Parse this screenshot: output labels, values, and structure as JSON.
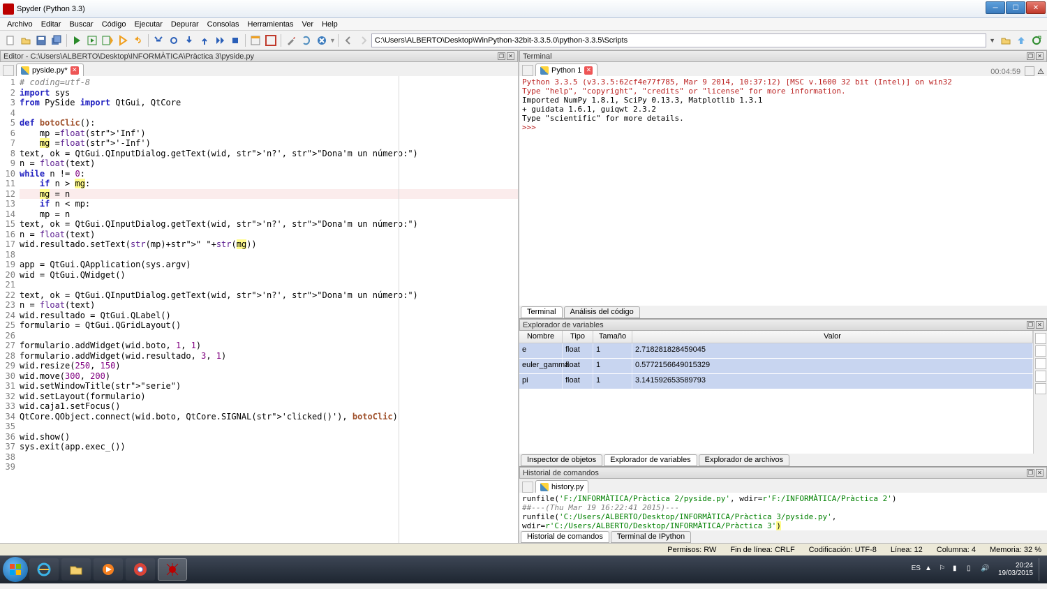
{
  "window": {
    "title": "Spyder (Python 3.3)"
  },
  "menu": [
    "Archivo",
    "Editar",
    "Buscar",
    "Código",
    "Ejecutar",
    "Depurar",
    "Consolas",
    "Herramientas",
    "Ver",
    "Help"
  ],
  "path": "C:\\Users\\ALBERTO\\Desktop\\WinPython-32bit-3.3.5.0\\python-3.3.5\\Scripts",
  "editor": {
    "pane_title": "Editor - C:\\Users\\ALBERTO\\Desktop\\INFORMÀTICA\\Pràctica 3\\pyside.py",
    "tab": "pyside.py*",
    "lines": [
      {
        "n": 1,
        "raw": "# coding=utf-8",
        "cls": "com"
      },
      {
        "n": 2,
        "raw": "import sys"
      },
      {
        "n": 3,
        "raw": "from PySide import QtGui, QtCore"
      },
      {
        "n": 4,
        "raw": ""
      },
      {
        "n": 5,
        "raw": "def botoClic():"
      },
      {
        "n": 6,
        "raw": "    mp =float('Inf')"
      },
      {
        "n": 7,
        "raw": "    mg =float('-Inf')"
      },
      {
        "n": 8,
        "raw": "text, ok = QtGui.QInputDialog.getText(wid, 'n?', \"Dona'm un número:\")"
      },
      {
        "n": 9,
        "raw": "n = float(text)"
      },
      {
        "n": 10,
        "raw": "while n != 0:"
      },
      {
        "n": 11,
        "raw": "    if n > mg:"
      },
      {
        "n": 12,
        "raw": "    mg = n",
        "warn": true,
        "hl": true
      },
      {
        "n": 13,
        "raw": "    if n < mp:"
      },
      {
        "n": 14,
        "raw": "    mp = n"
      },
      {
        "n": 15,
        "raw": "text, ok = QtGui.QInputDialog.getText(wid, 'n?', \"Dona'm un número:\")"
      },
      {
        "n": 16,
        "raw": "n = float(text)"
      },
      {
        "n": 17,
        "raw": "wid.resultado.setText(str(mp)+\" \"+str(mg))"
      },
      {
        "n": 18,
        "raw": ""
      },
      {
        "n": 19,
        "raw": "app = QtGui.QApplication(sys.argv)"
      },
      {
        "n": 20,
        "raw": "wid = QtGui.QWidget()"
      },
      {
        "n": 21,
        "raw": ""
      },
      {
        "n": 22,
        "raw": "text, ok = QtGui.QInputDialog.getText(wid, 'n?', \"Dona'm un número:\")"
      },
      {
        "n": 23,
        "raw": "n = float(text)"
      },
      {
        "n": 24,
        "raw": "wid.resultado = QtGui.QLabel()"
      },
      {
        "n": 25,
        "raw": "formulario = QtGui.QGridLayout()"
      },
      {
        "n": 26,
        "raw": ""
      },
      {
        "n": 27,
        "raw": "formulario.addWidget(wid.boto, 1, 1)"
      },
      {
        "n": 28,
        "raw": "formulario.addWidget(wid.resultado, 3, 1)"
      },
      {
        "n": 29,
        "raw": "wid.resize(250, 150)"
      },
      {
        "n": 30,
        "raw": "wid.move(300, 200)"
      },
      {
        "n": 31,
        "raw": "wid.setWindowTitle(\"serie\")"
      },
      {
        "n": 32,
        "raw": "wid.setLayout(formulario)"
      },
      {
        "n": 33,
        "raw": "wid.caja1.setFocus()"
      },
      {
        "n": 34,
        "raw": "QtCore.QObject.connect(wid.boto, QtCore.SIGNAL('clicked()'), botoClic)"
      },
      {
        "n": 35,
        "raw": ""
      },
      {
        "n": 36,
        "raw": "wid.show()"
      },
      {
        "n": 37,
        "raw": "sys.exit(app.exec_())"
      },
      {
        "n": 38,
        "raw": ""
      },
      {
        "n": 39,
        "raw": ""
      }
    ]
  },
  "terminal": {
    "pane_title": "Terminal",
    "tab": "Python 1",
    "timer": "00:04:59",
    "lines": [
      {
        "t": "Python 3.3.5 (v3.3.5:62cf4e77f785, Mar  9 2014, 10:37:12) [MSC v.1600 32 bit (Intel)] on win32",
        "c": "red"
      },
      {
        "t": "Type \"help\", \"copyright\", \"credits\" or \"license\" for more information.",
        "c": "red"
      },
      {
        "t": ""
      },
      {
        "t": "Imported NumPy 1.8.1, SciPy 0.13.3, Matplotlib 1.3.1"
      },
      {
        "t": "+ guidata 1.6.1, guiqwt 2.3.2"
      },
      {
        "t": "Type \"scientific\" for more details."
      },
      {
        "t": ">>>",
        "c": "red"
      }
    ],
    "bottom_tabs": [
      {
        "label": "Terminal",
        "active": true
      },
      {
        "label": "Análisis del código",
        "active": false
      }
    ]
  },
  "varexp": {
    "title": "Explorador de variables",
    "cols": {
      "name": "Nombre",
      "type": "Tipo",
      "size": "Tamaño",
      "value": "Valor"
    },
    "rows": [
      {
        "name": "e",
        "type": "float",
        "size": "1",
        "value": "2.718281828459045"
      },
      {
        "name": "euler_gamma",
        "type": "float",
        "size": "1",
        "value": "0.5772156649015329"
      },
      {
        "name": "pi",
        "type": "float",
        "size": "1",
        "value": "3.141592653589793"
      }
    ],
    "bottom_tabs": [
      {
        "label": "Inspector de objetos",
        "active": false
      },
      {
        "label": "Explorador de variables",
        "active": true
      },
      {
        "label": "Explorador de archivos",
        "active": false
      }
    ]
  },
  "history": {
    "title": "Historial de comandos",
    "tab": "history.py",
    "lines": [
      {
        "pre": "runfile(",
        "str": "'F:/INFORMÀTICA/Pràctica 2/pyside.py'",
        "mid": ", wdir=",
        "str2": "r'F:/INFORMÀTICA/Pràctica 2'",
        "post": ")"
      },
      {
        "com": "##---(Thu Mar 19 16:22:41 2015)---"
      },
      {
        "pre": "runfile(",
        "str": "'C:/Users/ALBERTO/Desktop/INFORMÀTICA/Pràctica 3/pyside.py'",
        "mid": ", wdir=",
        "str2": "r'C:/Users/ALBERTO/Desktop/INFORMÀTICA/Pràctica 3'",
        "post": ")",
        "mark": true
      }
    ],
    "bottom_tabs": [
      {
        "label": "Historial de comandos",
        "active": true
      },
      {
        "label": "Terminal de IPython",
        "active": false
      }
    ]
  },
  "statusbar": {
    "permisos": "Permisos:  RW",
    "fin": "Fin de línea:  CRLF",
    "enc": "Codificación:  UTF-8",
    "line": "Línea:  12",
    "col": "Columna:  4",
    "mem": "Memoria:  32  %"
  },
  "taskbar": {
    "lang": "ES",
    "time": "20:24",
    "date": "19/03/2015"
  }
}
